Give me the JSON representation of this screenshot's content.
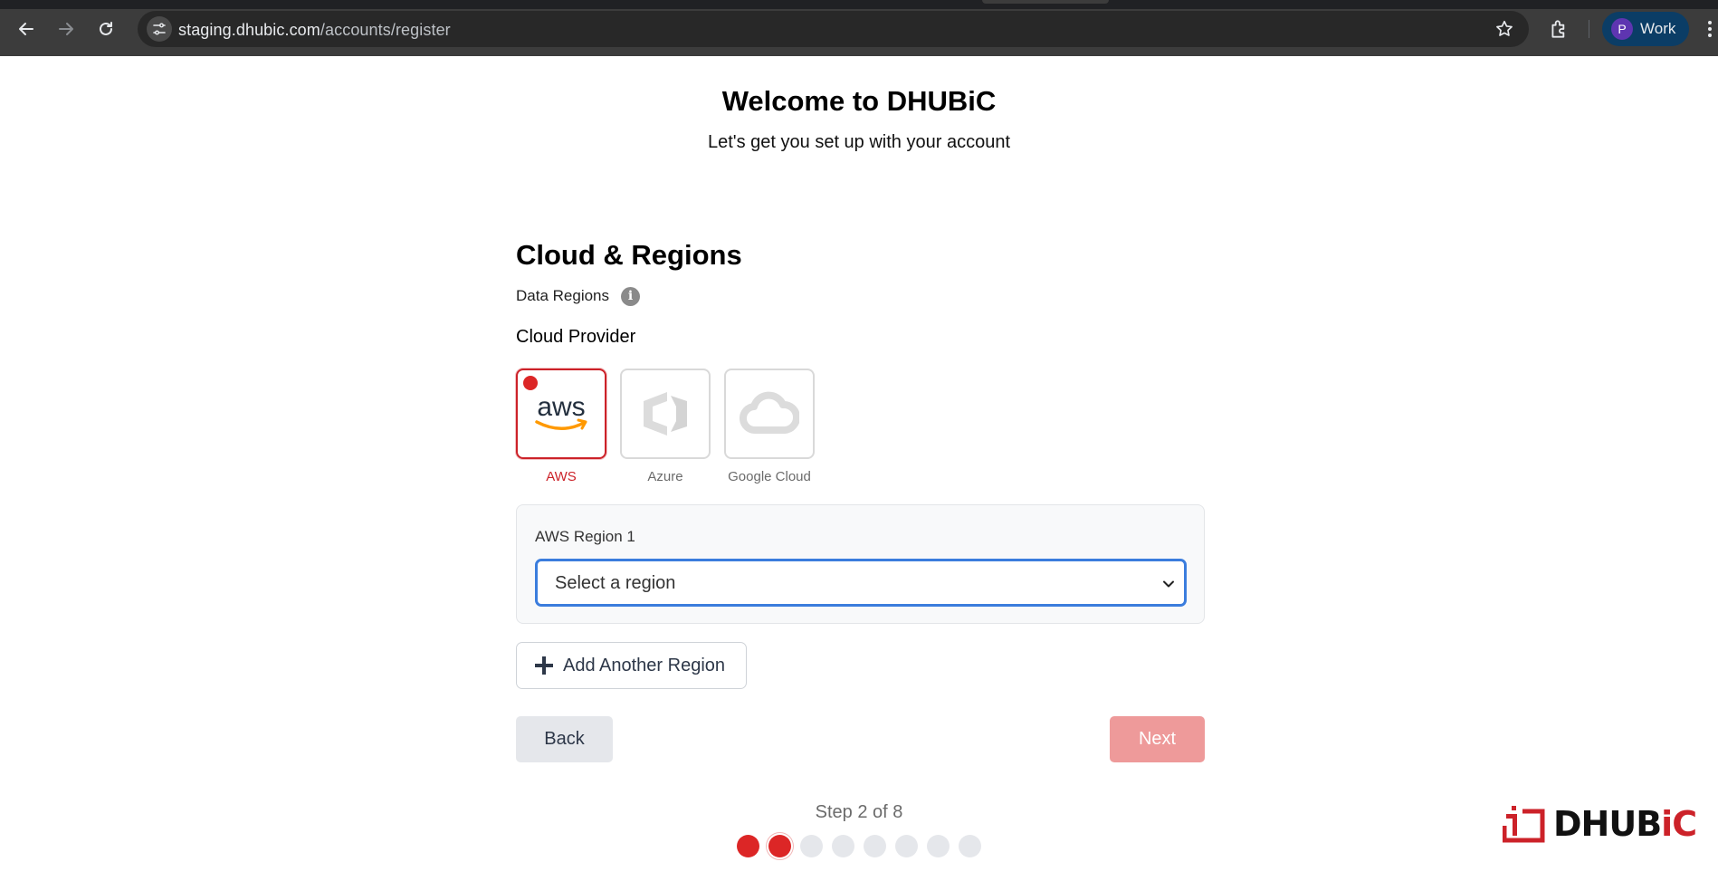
{
  "browser": {
    "url_host": "staging.dhubic.com",
    "url_path": "/accounts/register",
    "profile_initial": "P",
    "profile_label": "Work"
  },
  "header": {
    "title": "Welcome to DHUBiC",
    "subtitle": "Let's get you set up with your account"
  },
  "section": {
    "title": "Cloud & Regions",
    "data_regions_label": "Data Regions",
    "info_glyph": "i",
    "cloud_provider_label": "Cloud Provider"
  },
  "providers": [
    {
      "name": "AWS",
      "logo_text": "aws",
      "selected": true
    },
    {
      "name": "Azure",
      "selected": false
    },
    {
      "name": "Google Cloud",
      "selected": false
    }
  ],
  "region": {
    "label": "AWS Region 1",
    "placeholder": "Select a region"
  },
  "actions": {
    "add_region": "Add Another Region",
    "back": "Back",
    "next": "Next"
  },
  "progress": {
    "step_text": "Step 2 of 8",
    "current": 2,
    "total": 8
  },
  "brand": {
    "text_main": "DHUB",
    "text_accent": "iC"
  },
  "colors": {
    "accent": "#dc2626",
    "next_disabled": "#ee9a9a",
    "focus": "#3b7ddd"
  }
}
